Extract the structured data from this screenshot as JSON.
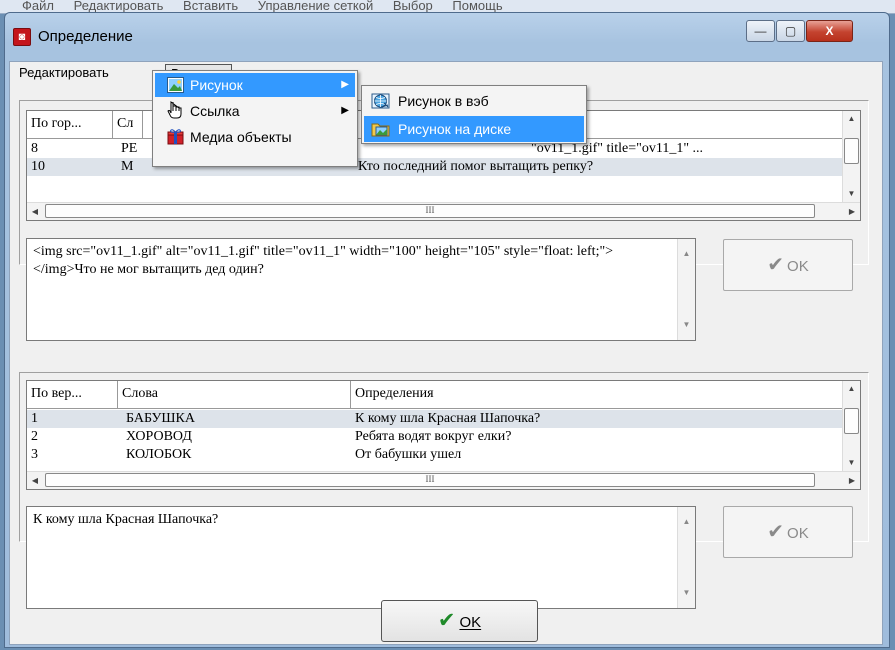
{
  "background_menu": [
    "Файл",
    "Редактировать",
    "Вставить",
    "Управление сеткой",
    "Выбор",
    "Помощь"
  ],
  "window": {
    "title": "Определение",
    "buttons": {
      "minimize": "—",
      "maximize": "▢",
      "close": "X"
    }
  },
  "menubar": {
    "edit": "Редактировать",
    "insert": "Вставить"
  },
  "insert_menu": {
    "items": [
      {
        "label": "Рисунок",
        "icon": "picture-icon",
        "has_submenu": true
      },
      {
        "label": "Ссылка",
        "icon": "hand-link-icon",
        "has_submenu": true
      },
      {
        "label": "Медиа объекты",
        "icon": "gift-media-icon",
        "has_submenu": false
      }
    ],
    "submenu": [
      {
        "label": "Рисунок в вэб",
        "icon": "web-picture-icon"
      },
      {
        "label": "Рисунок на диске",
        "icon": "folder-picture-icon"
      }
    ]
  },
  "grid_top": {
    "columns": [
      "По гор...",
      "Сл"
    ],
    "rows": [
      {
        "num": "8",
        "word": "РЕ",
        "def": "\"ov11_1.gif\" title=\"ov11_1\" ..."
      },
      {
        "num": "10",
        "word": "М",
        "def": "Кто последний помог вытащить репку?"
      }
    ],
    "scroll_thumb_mark": "III"
  },
  "editor_top": {
    "text": "<img src=\"ov11_1.gif\" alt=\"ov11_1.gif\" title=\"ov11_1\" width=\"100\" height=\"105\" style=\"float: left;\"></img>Что не мог вытащить дед один?"
  },
  "ok_top": "OK",
  "grid_bottom": {
    "columns": [
      "По вер...",
      "Слова",
      "Определения"
    ],
    "rows": [
      {
        "num": "1",
        "word": "БАБУШКА",
        "def": "К кому шла Красная Шапочка?"
      },
      {
        "num": "2",
        "word": "ХОРОВОД",
        "def": "Ребята водят вокруг елки?"
      },
      {
        "num": "3",
        "word": "КОЛОБОК",
        "def": "От бабушки ушел"
      }
    ],
    "scroll_thumb_mark": "III"
  },
  "editor_bottom": {
    "text": "К кому шла Красная Шапочка?"
  },
  "ok_bottom": "OK",
  "ok_main": "OK",
  "colors": {
    "highlight": "#3399ff",
    "check_green": "#1f8a2a",
    "title_icon": "#c4151c"
  }
}
